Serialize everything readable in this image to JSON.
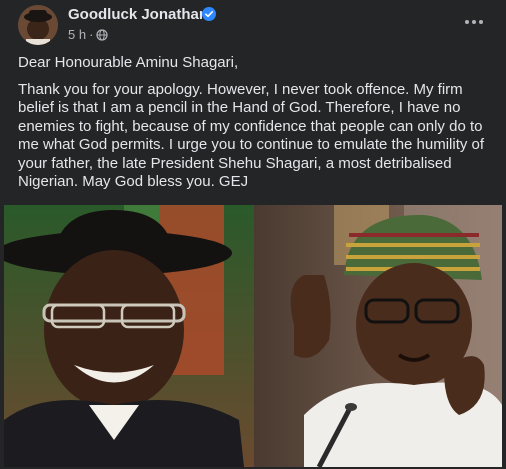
{
  "post": {
    "author": "Goodluck Jonathan",
    "time": "5 h",
    "separator": "·",
    "icons": {
      "verified": "verified-badge-icon",
      "audience": "globe-icon",
      "more": "more-options-icon"
    },
    "greeting": "Dear Honourable Aminu Shagari,",
    "message": "Thank you for your apology. However, I never took offence. My firm belief is that I am a pencil in the Hand of God. Therefore, I have no enemies to fight, because of my confidence that people can only do to me what God permits. I urge you to continue to emulate the humility of your father, the late President Shehu Shagari, a most detribalised Nigerian. May God bless you. GEJ"
  },
  "colors": {
    "background": "#242526",
    "text": "#e4e6eb",
    "secondary_text": "#b0b3b8",
    "verified_blue": "#2d88ff"
  }
}
